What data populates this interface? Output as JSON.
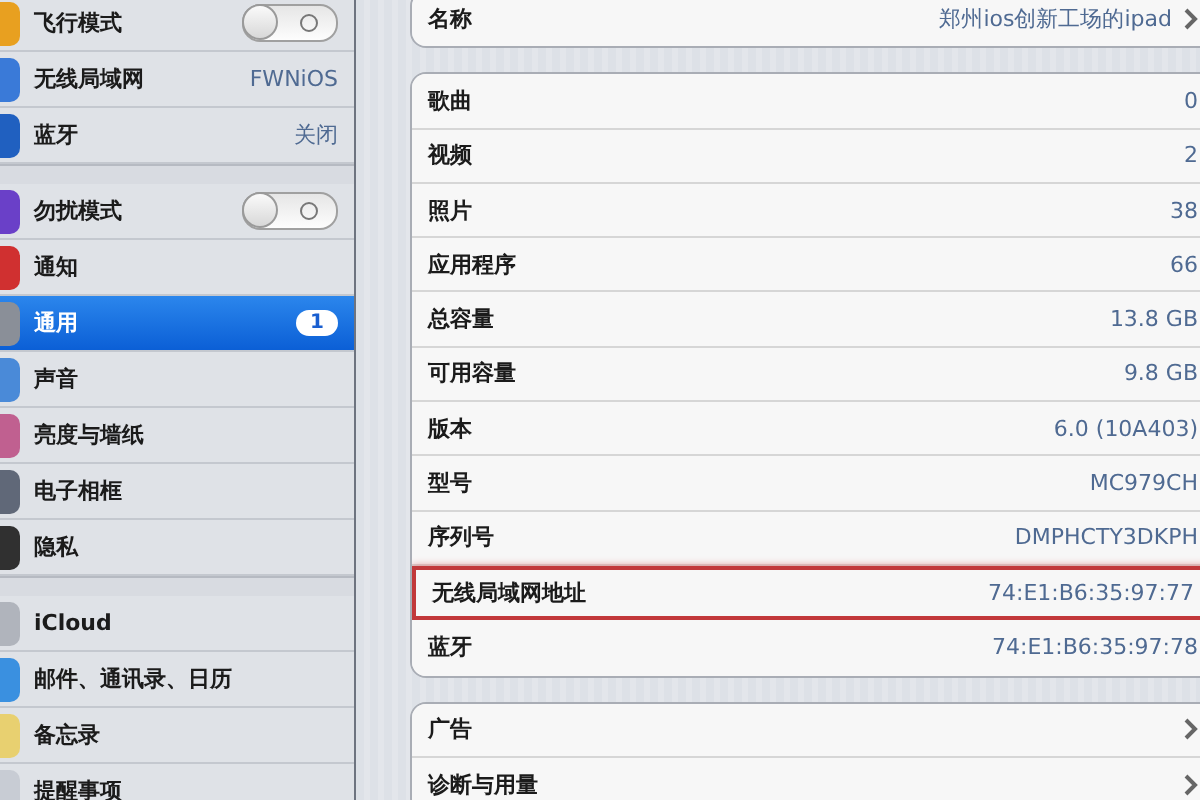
{
  "sidebar": {
    "groups": [
      {
        "items": [
          {
            "label": "飞行模式",
            "kind": "toggle",
            "on": false,
            "selected": false
          },
          {
            "label": "无线局域网",
            "kind": "value",
            "value": "FWNiOS",
            "selected": false
          },
          {
            "label": "蓝牙",
            "kind": "value",
            "value": "关闭",
            "selected": false
          }
        ]
      },
      {
        "items": [
          {
            "label": "勿扰模式",
            "kind": "toggle",
            "on": false,
            "selected": false
          },
          {
            "label": "通知",
            "kind": "plain",
            "selected": false
          },
          {
            "label": "通用",
            "kind": "badge",
            "badge": "1",
            "selected": true
          },
          {
            "label": "声音",
            "kind": "plain",
            "selected": false
          },
          {
            "label": "亮度与墙纸",
            "kind": "plain",
            "selected": false
          },
          {
            "label": "电子相框",
            "kind": "plain",
            "selected": false
          },
          {
            "label": "隐私",
            "kind": "plain",
            "selected": false
          }
        ]
      },
      {
        "items": [
          {
            "label": "iCloud",
            "kind": "plain",
            "selected": false
          },
          {
            "label": "邮件、通讯录、日历",
            "kind": "plain",
            "selected": false
          },
          {
            "label": "备忘录",
            "kind": "plain",
            "selected": false
          },
          {
            "label": "提醒事项",
            "kind": "plain",
            "selected": false
          }
        ]
      }
    ]
  },
  "detail": {
    "sections": [
      {
        "rows": [
          {
            "label": "名称",
            "value": "郑州ios创新工场的ipad",
            "chevron": true,
            "highlighted": false
          }
        ]
      },
      {
        "rows": [
          {
            "label": "歌曲",
            "value": "0",
            "chevron": false,
            "highlighted": false
          },
          {
            "label": "视频",
            "value": "2",
            "chevron": false,
            "highlighted": false
          },
          {
            "label": "照片",
            "value": "38",
            "chevron": false,
            "highlighted": false
          },
          {
            "label": "应用程序",
            "value": "66",
            "chevron": false,
            "highlighted": false
          },
          {
            "label": "总容量",
            "value": "13.8 GB",
            "chevron": false,
            "highlighted": false
          },
          {
            "label": "可用容量",
            "value": "9.8 GB",
            "chevron": false,
            "highlighted": false
          },
          {
            "label": "版本",
            "value": "6.0 (10A403)",
            "chevron": false,
            "highlighted": false
          },
          {
            "label": "型号",
            "value": "MC979CH",
            "chevron": false,
            "highlighted": false
          },
          {
            "label": "序列号",
            "value": "DMPHCTY3DKPH",
            "chevron": false,
            "highlighted": false
          },
          {
            "label": "无线局域网地址",
            "value": "74:E1:B6:35:97:77",
            "chevron": false,
            "highlighted": true
          },
          {
            "label": "蓝牙",
            "value": "74:E1:B6:35:97:78",
            "chevron": false,
            "highlighted": false
          }
        ]
      },
      {
        "rows": [
          {
            "label": "广告",
            "chevron": true,
            "highlighted": false
          },
          {
            "label": "诊断与用量",
            "chevron": true,
            "highlighted": false
          }
        ]
      }
    ]
  }
}
